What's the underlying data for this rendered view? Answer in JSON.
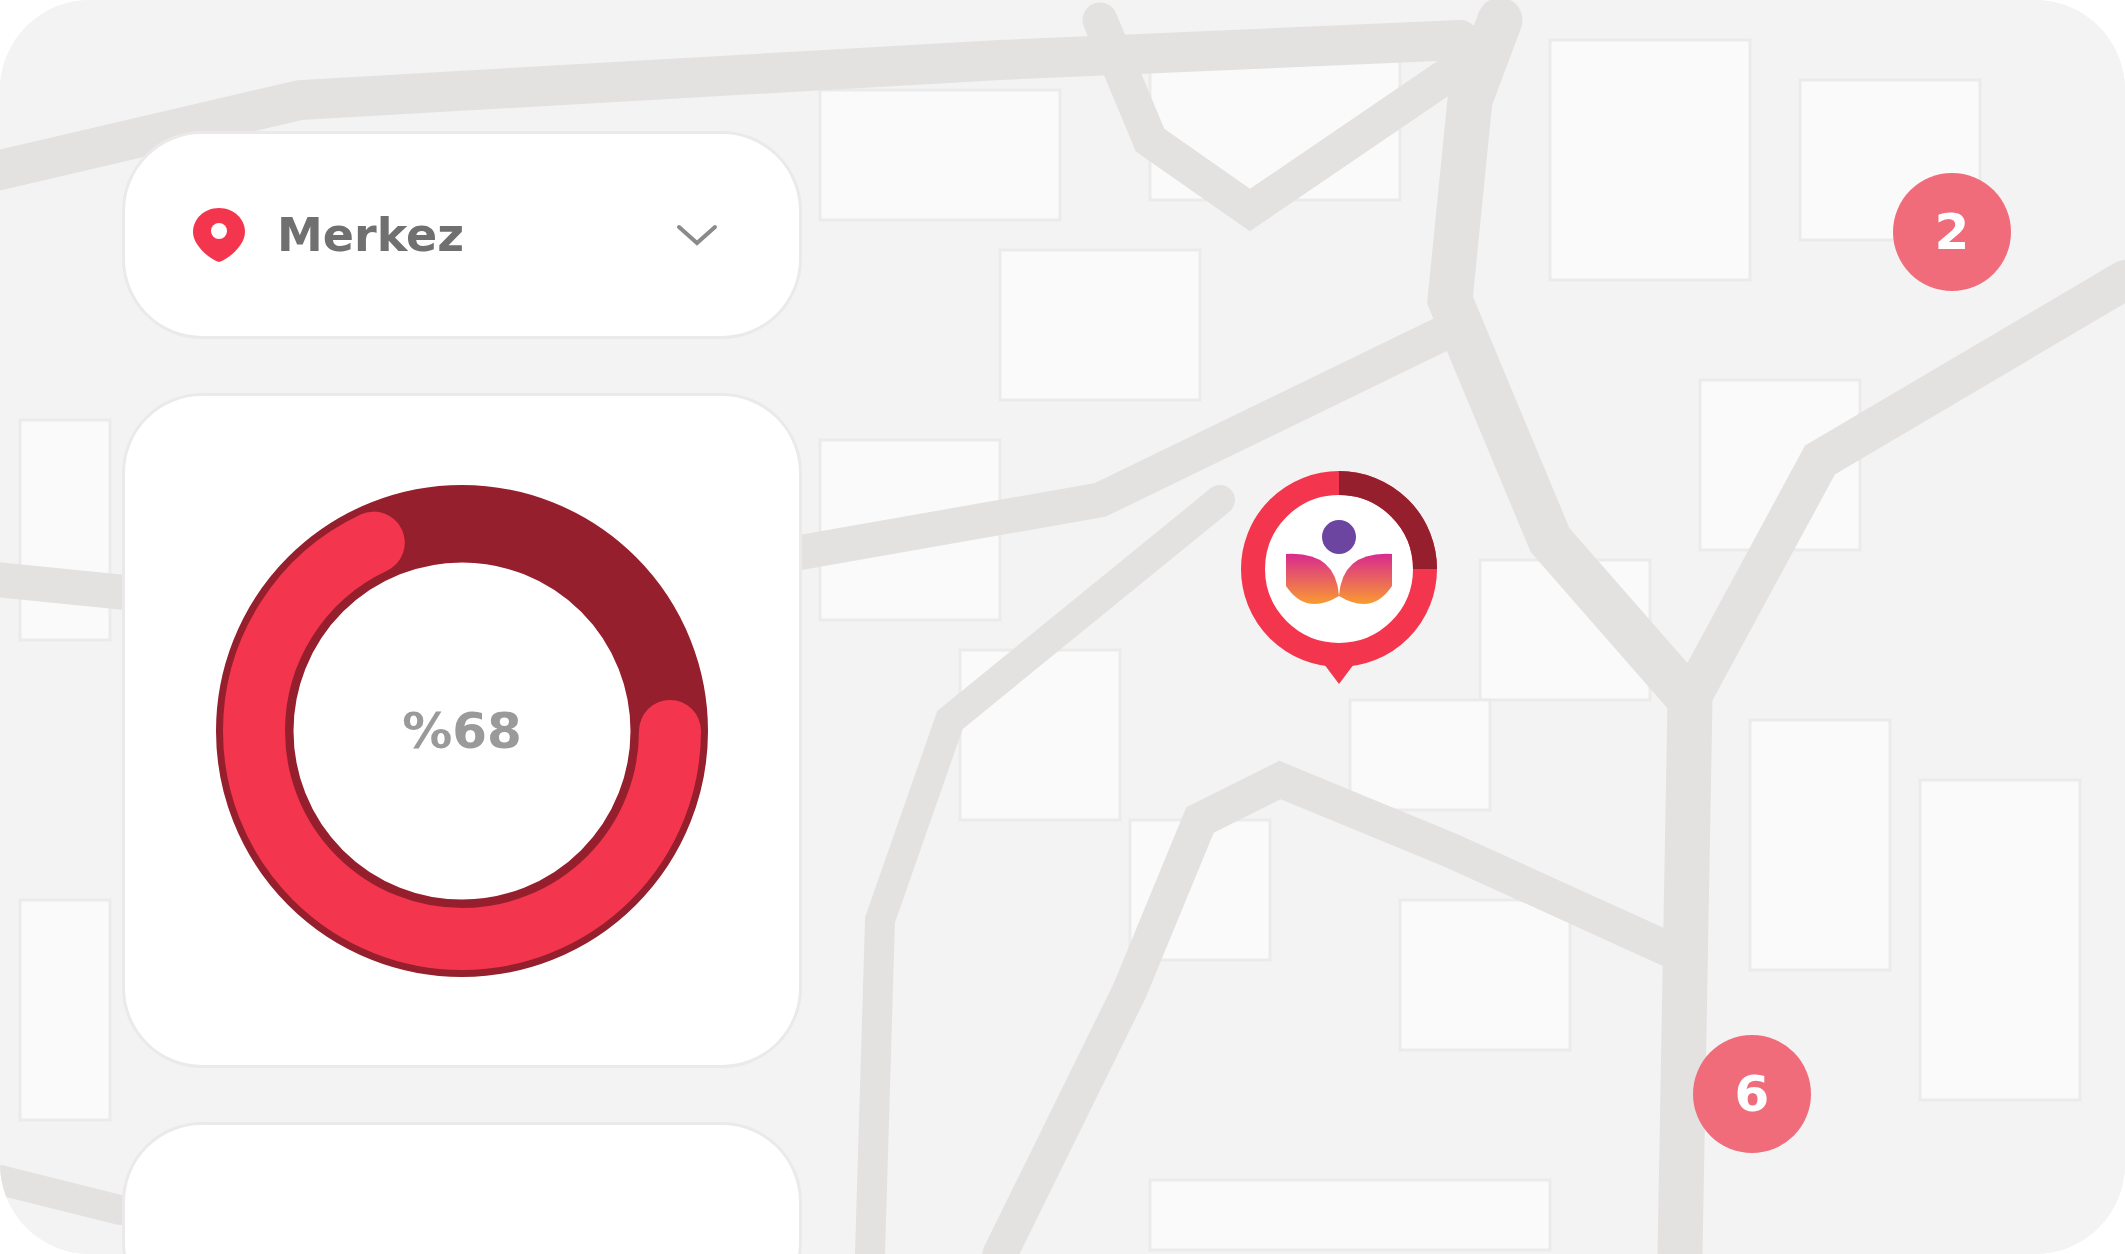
{
  "location_selector": {
    "label": "Merkez"
  },
  "progress": {
    "level": 0.68,
    "reading": "%68"
  },
  "clusters": [
    {
      "count": "2"
    },
    {
      "count": "6"
    }
  ]
}
